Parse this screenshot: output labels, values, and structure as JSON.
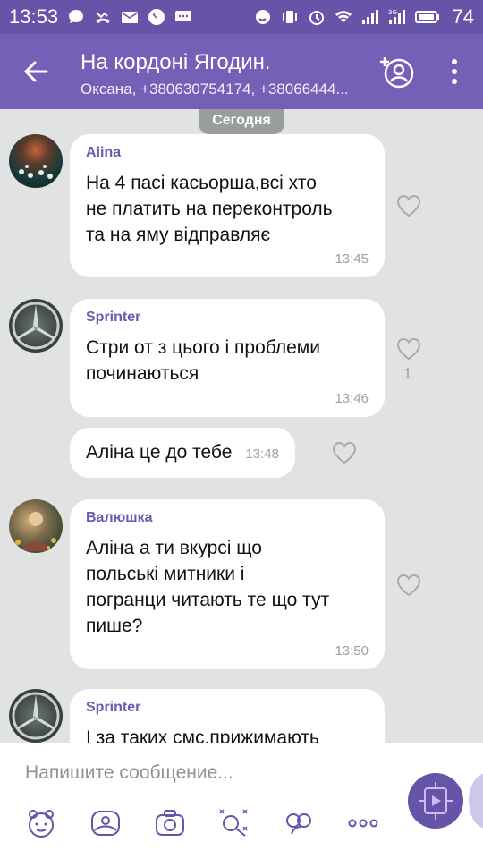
{
  "status_bar": {
    "time": "13:53",
    "battery": "74",
    "network": "3G"
  },
  "header": {
    "title": "На кордоні Ягодин.",
    "subtitle": "Оксана, +380630754174, +38066444..."
  },
  "date_divider": "Сегодня",
  "messages": [
    {
      "sender": "Alina",
      "text_lines": [
        "На 4 пасі касьорша,всі хто",
        "не платить на переконтроль",
        "та на яму відправляє"
      ],
      "time": "13:45",
      "likes": ""
    },
    {
      "sender": "Sprinter",
      "text_lines": [
        "Стри от з цього і проблеми",
        "починаються"
      ],
      "time": "13:46",
      "likes": "1"
    },
    {
      "sender": "",
      "text_lines": [
        "Аліна це до тебе"
      ],
      "time": "13:48",
      "likes": ""
    },
    {
      "sender": "Валюшка",
      "text_lines": [
        "Аліна а ти вкурсі що",
        "польські митники і",
        "погранци читають те що тут",
        "пише?"
      ],
      "time": "13:50",
      "likes": ""
    },
    {
      "sender": "Sprinter",
      "text_lines": [
        "І за таких смс,прижимають"
      ],
      "time": "",
      "likes": ""
    }
  ],
  "composer": {
    "placeholder": "Напишите сообщение..."
  },
  "colors": {
    "statusbar": "#6654a9",
    "header": "#7460b7",
    "accent": "#6a5ab0",
    "background": "#e1e3e3"
  },
  "icons": [
    "back-arrow-icon",
    "add-member-icon",
    "more-icon",
    "heart-icon",
    "sticker-icon",
    "gallery-icon",
    "camera-icon",
    "doodle-icon",
    "gif-icon",
    "more-options-icon",
    "send-icon"
  ]
}
